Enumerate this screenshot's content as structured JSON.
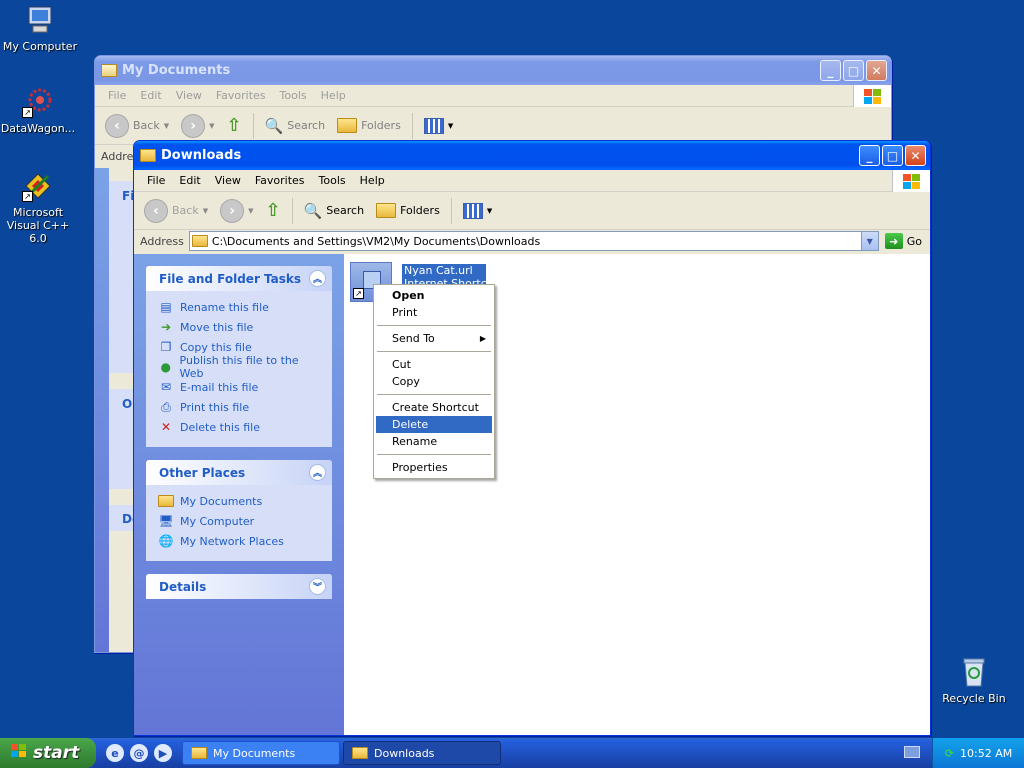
{
  "desktop": {
    "icons": [
      {
        "label": "My Computer"
      },
      {
        "label": "DataWagon..."
      },
      {
        "label": "Microsoft Visual C++ 6.0"
      },
      {
        "label": "Recycle Bin"
      }
    ]
  },
  "bg_window": {
    "title": "My Documents",
    "menu": [
      "File",
      "Edit",
      "View",
      "Favorites",
      "Tools",
      "Help"
    ],
    "toolbar": {
      "back": "Back",
      "search": "Search",
      "folders": "Folders"
    },
    "address_label": "Addre",
    "panel_fragments": [
      "Fi",
      "O",
      "De"
    ]
  },
  "window": {
    "title": "Downloads",
    "menu": [
      "File",
      "Edit",
      "View",
      "Favorites",
      "Tools",
      "Help"
    ],
    "toolbar": {
      "back": "Back",
      "search": "Search",
      "folders": "Folders"
    },
    "address": {
      "label": "Address",
      "value": "C:\\Documents and Settings\\VM2\\My Documents\\Downloads",
      "go": "Go"
    },
    "file_tasks": {
      "title": "File and Folder Tasks",
      "items": [
        "Rename this file",
        "Move this file",
        "Copy this file",
        "Publish this file to the Web",
        "E-mail this file",
        "Print this file",
        "Delete this file"
      ]
    },
    "other_places": {
      "title": "Other Places",
      "items": [
        "My Documents",
        "My Computer",
        "My Network Places"
      ]
    },
    "details": {
      "title": "Details"
    },
    "file": {
      "name": "Nyan Cat.url",
      "type": "Internet Shortcut"
    }
  },
  "context_menu": {
    "items": [
      {
        "label": "Open",
        "bold": true
      },
      {
        "label": "Print"
      },
      {
        "sep": true
      },
      {
        "label": "Send To",
        "submenu": true
      },
      {
        "sep": true
      },
      {
        "label": "Cut"
      },
      {
        "label": "Copy"
      },
      {
        "sep": true
      },
      {
        "label": "Create Shortcut"
      },
      {
        "label": "Delete",
        "highlighted": true
      },
      {
        "label": "Rename"
      },
      {
        "sep": true
      },
      {
        "label": "Properties"
      }
    ]
  },
  "taskbar": {
    "start": "start",
    "buttons": [
      "My Documents",
      "Downloads"
    ],
    "clock": "10:52 AM"
  },
  "colors": {
    "desktop": "#0a469b",
    "highlight": "#316ac5",
    "task_link": "#215dc6"
  }
}
